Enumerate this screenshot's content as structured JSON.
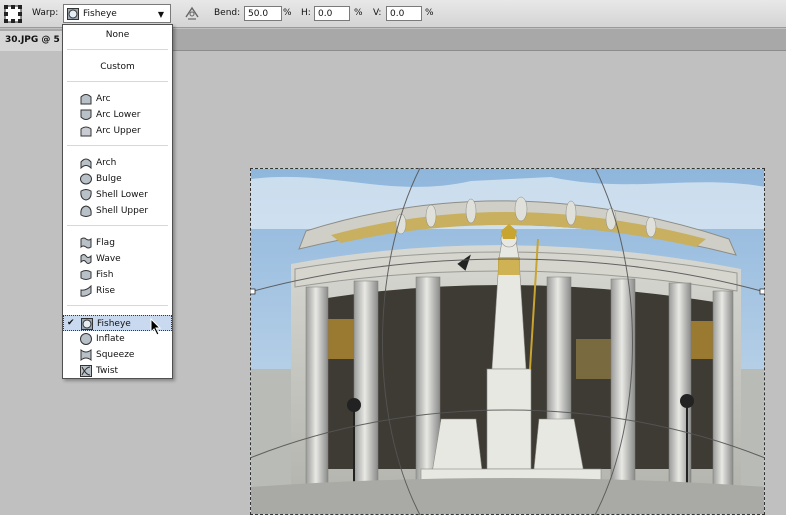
{
  "options_bar": {
    "warp_label": "Warp:",
    "warp_style": "Fisheye",
    "bend_label": "Bend:",
    "bend_value": "50.0",
    "bend_unit": "%",
    "h_label": "H:",
    "h_value": "0.0",
    "h_unit": "%",
    "v_label": "V:",
    "v_value": "0.0",
    "v_unit": "%"
  },
  "document_tab": {
    "title": "30.JPG @ 5"
  },
  "warp_menu": {
    "items": [
      {
        "label": "None"
      },
      {
        "label": "Custom"
      },
      {
        "label": "Arc",
        "icon": "arc-icon"
      },
      {
        "label": "Arc Lower",
        "icon": "arc-lower-icon"
      },
      {
        "label": "Arc Upper",
        "icon": "arc-upper-icon"
      },
      {
        "label": "Arch",
        "icon": "arch-icon"
      },
      {
        "label": "Bulge",
        "icon": "bulge-icon"
      },
      {
        "label": "Shell Lower",
        "icon": "shell-lower-icon"
      },
      {
        "label": "Shell Upper",
        "icon": "shell-upper-icon"
      },
      {
        "label": "Flag",
        "icon": "flag-icon"
      },
      {
        "label": "Wave",
        "icon": "wave-icon"
      },
      {
        "label": "Fish",
        "icon": "fish-icon"
      },
      {
        "label": "Rise",
        "icon": "rise-icon"
      },
      {
        "label": "Fisheye",
        "icon": "fisheye-icon",
        "checked": true
      },
      {
        "label": "Inflate",
        "icon": "inflate-icon"
      },
      {
        "label": "Squeeze",
        "icon": "squeeze-icon"
      },
      {
        "label": "Twist",
        "icon": "twist-icon"
      }
    ],
    "selected": "Fisheye"
  },
  "colors": {
    "menu_highlight": "#c9daf0",
    "toolbar_bg": "#dcdcdc",
    "workspace_bg": "#c0c0c0"
  }
}
